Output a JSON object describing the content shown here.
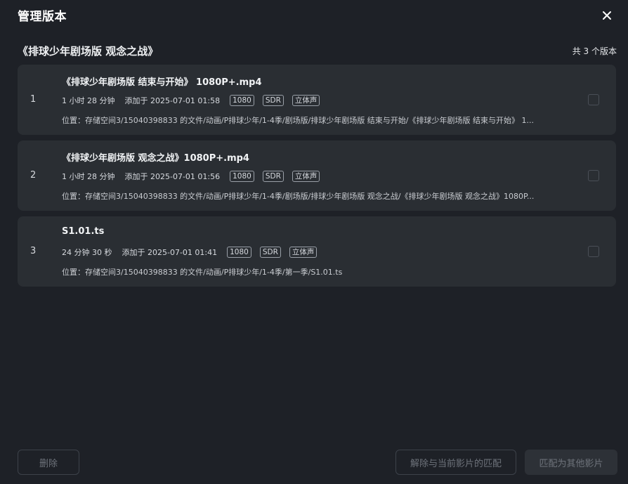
{
  "dialog": {
    "title": "管理版本",
    "close_icon": "close-icon"
  },
  "movie": {
    "title": "《排球少年剧场版 观念之战》",
    "version_count": "共 3 个版本"
  },
  "versions": [
    {
      "index": "1",
      "name": "《排球少年剧场版 结束与开始》 1080P+.mp4",
      "duration": "1 小时 28 分钟",
      "added": "添加于 2025-07-01 01:58",
      "badges": [
        "1080",
        "SDR",
        "立体声"
      ],
      "path": "位置：存储空间3/15040398833 的文件/动画/P排球少年/1-4季/剧场版/排球少年剧场版 结束与开始/《排球少年剧场版 结束与开始》 1...",
      "checked": false
    },
    {
      "index": "2",
      "name": "《排球少年剧场版 观念之战》1080P+.mp4",
      "duration": "1 小时 28 分钟",
      "added": "添加于 2025-07-01 01:56",
      "badges": [
        "1080",
        "SDR",
        "立体声"
      ],
      "path": "位置：存储空间3/15040398833 的文件/动画/P排球少年/1-4季/剧场版/排球少年剧场版 观念之战/《排球少年剧场版 观念之战》1080P...",
      "checked": false
    },
    {
      "index": "3",
      "name": "S1.01.ts",
      "duration": "24 分钟 30 秒",
      "added": "添加于 2025-07-01 01:41",
      "badges": [
        "1080",
        "SDR",
        "立体声"
      ],
      "path": "位置：存储空间3/15040398833 的文件/动画/P排球少年/1-4季/第一季/S1.01.ts",
      "checked": false
    }
  ],
  "actions": {
    "delete_label": "删除",
    "unmatch_label": "解除与当前影片的匹配",
    "match_other_label": "匹配为其他影片"
  },
  "colors": {
    "background": "#1e2127",
    "card": "#2a2e33",
    "text": "#e6e8eb",
    "disabled_text": "#6e737b"
  }
}
